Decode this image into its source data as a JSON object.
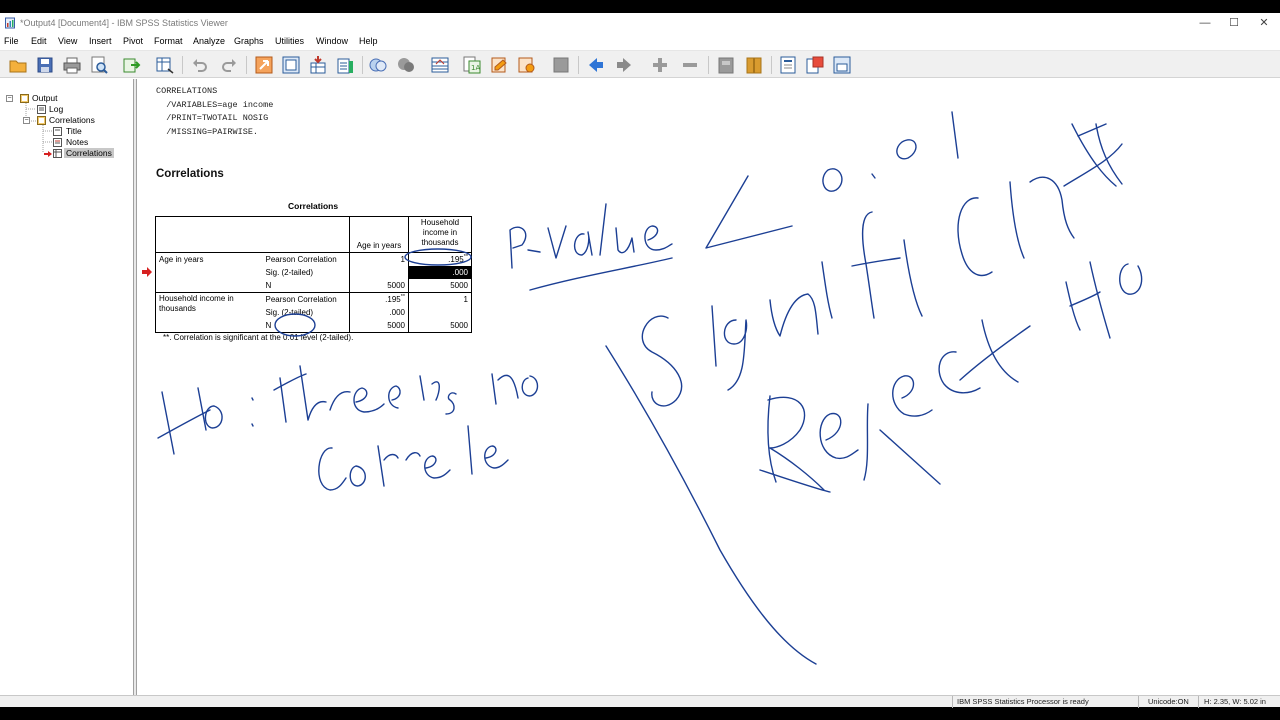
{
  "window": {
    "title": "*Output4 [Document4] - IBM SPSS Statistics Viewer",
    "controls": {
      "minimize": "—",
      "maximize": "☐",
      "close": "✕"
    }
  },
  "menu": {
    "file": "File",
    "edit": "Edit",
    "view": "View",
    "insert": "Insert",
    "pivot": "Pivot",
    "format": "Format",
    "analyze": "Analyze",
    "graphs": "Graphs",
    "utilities": "Utilities",
    "window": "Window",
    "help": "Help"
  },
  "navigator": {
    "output": "Output",
    "log": "Log",
    "correlations": "Correlations",
    "title": "Title",
    "notes": "Notes",
    "correlations_table": "Correlations"
  },
  "syntax": "CORRELATIONS\n  /VARIABLES=age income\n  /PRINT=TWOTAIL NOSIG\n  /MISSING=PAIRWISE.",
  "section_title": "Correlations",
  "table": {
    "caption": "Correlations",
    "col_age": "Age in years",
    "col_income": "Household income in thousands",
    "row_age": "Age in years",
    "row_income": "Household income in thousands",
    "pearson": "Pearson Correlation",
    "sig": "Sig. (2-tailed)",
    "n": "N",
    "age_age_r": "1",
    "age_income_r": ".195",
    "age_income_sig": ".000",
    "age_n1": "5000",
    "age_n2": "5000",
    "income_age_r": ".195",
    "income_age_sig": ".000",
    "income_income_r": "1",
    "income_n1": "5000",
    "income_n2": "5000",
    "sig_marker": "**",
    "footnote": "**. Correlation is significant at the 0.01 level (2-tailed)."
  },
  "status": {
    "processor": "IBM SPSS Statistics Processor is ready",
    "unicode": "Unicode:ON",
    "dims": "H: 2.35, W: 5.02 in"
  },
  "annotations": {
    "color": "#1c3f94",
    "items": [
      "P-Value < 0.01",
      "Significant",
      "Reject Ho",
      "Ho: There is no correle"
    ]
  }
}
